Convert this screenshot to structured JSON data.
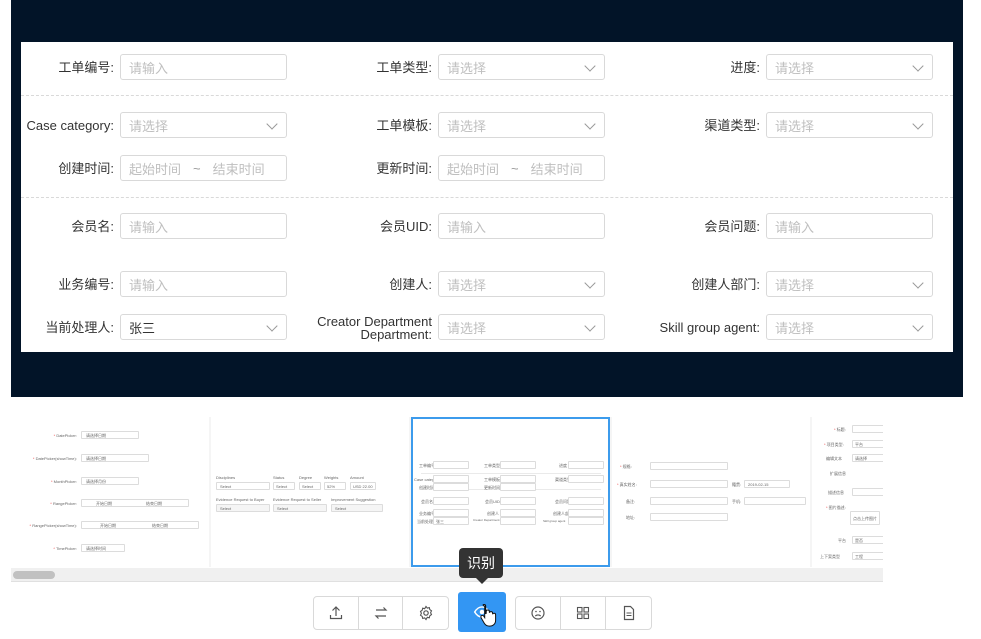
{
  "form": {
    "row1": [
      {
        "label": "工单编号",
        "placeholder": "请输入",
        "kind": "input"
      },
      {
        "label": "工单类型",
        "placeholder": "请选择",
        "kind": "select"
      },
      {
        "label": "进度",
        "placeholder": "请选择",
        "kind": "select"
      }
    ],
    "row2": [
      {
        "label": "Case category",
        "placeholder": "请选择",
        "kind": "select"
      },
      {
        "label": "工单模板",
        "placeholder": "请选择",
        "kind": "select"
      },
      {
        "label": "渠道类型",
        "placeholder": "请选择",
        "kind": "select"
      }
    ],
    "row3": [
      {
        "label": "创建时间",
        "start": "起始时间",
        "sep": "~",
        "end": "结束时间",
        "kind": "range"
      },
      {
        "label": "更新时间",
        "start": "起始时间",
        "sep": "~",
        "end": "结束时间",
        "kind": "range"
      }
    ],
    "row4": [
      {
        "label": "会员名",
        "placeholder": "请输入",
        "kind": "input"
      },
      {
        "label": "会员UID",
        "placeholder": "请输入",
        "kind": "input"
      },
      {
        "label": "会员问题",
        "placeholder": "请输入",
        "kind": "input"
      }
    ],
    "row5": [
      {
        "label": "业务编号",
        "placeholder": "请输入",
        "kind": "input"
      },
      {
        "label": "创建人",
        "placeholder": "请选择",
        "kind": "select"
      },
      {
        "label": "创建人部门",
        "placeholder": "请选择",
        "kind": "select"
      }
    ],
    "row6": [
      {
        "label": "当前处理人",
        "value": "张三",
        "kind": "select"
      },
      {
        "label_line1": "Creator Department",
        "label_line2": "Department",
        "placeholder": "请选择",
        "kind": "select"
      },
      {
        "label": "Skill group agent",
        "placeholder": "请选择",
        "kind": "select"
      }
    ],
    "colon": ":"
  },
  "thumbnails": {
    "t1": {
      "labels": [
        "DatePicker",
        "DatePicker(showTime)",
        "MonthPicker",
        "RangePicker",
        "RangePicker(showTime)",
        "TimePicker"
      ],
      "placeholders": [
        "请选择日期",
        "请选择日期",
        "请选择月份",
        "开始日期",
        "结束日期",
        "开始日期",
        "结束日期",
        "请选择时间"
      ]
    },
    "t2": {
      "labels": [
        "Disciplines",
        "Status",
        "Degree",
        "Weights",
        "Amount",
        "Evidence Request to Buyer",
        "Evidence Request to Seller",
        "Improvement Suggestion"
      ],
      "values": [
        "Select",
        "Select",
        "Select",
        "52%",
        "USD 22.00",
        "Select",
        "Select",
        "Select"
      ]
    },
    "t4": {
      "labels": [
        "规格",
        "真实姓名",
        "籍贯",
        "地址",
        "备注",
        "手机"
      ],
      "values": [
        "2019-02-15"
      ]
    },
    "t5": {
      "labels": [
        "标题",
        "项目类型",
        "编辑文本",
        "扩展信息",
        "描述信息",
        "图片描述",
        "平台",
        "上下案类型"
      ],
      "values": [
        "平台",
        "请选择",
        "点击上传图片",
        "是否",
        "工程"
      ]
    }
  },
  "tooltip": {
    "text": "识别"
  },
  "toolbar": {
    "icons": [
      "upload-icon",
      "swap-icon",
      "gear-icon",
      "eye-icon",
      "sad-face-icon",
      "grid-icon",
      "document-icon"
    ]
  },
  "colors": {
    "accent": "#3396f3",
    "dark_bg": "#021428",
    "selection": "#3c9bec"
  }
}
